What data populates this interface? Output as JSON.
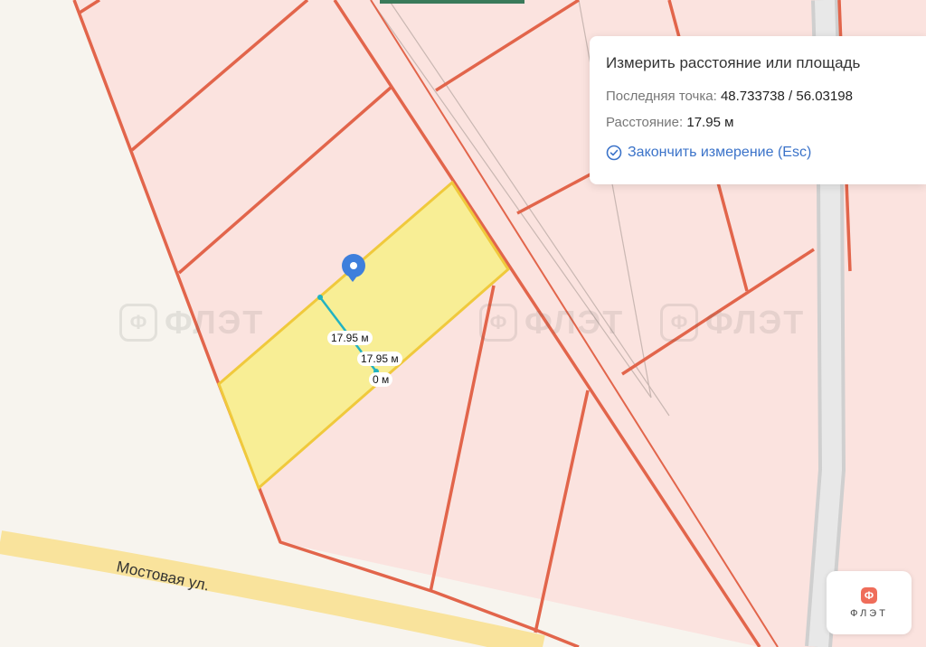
{
  "measure_panel": {
    "title": "Измерить расстояние или площадь",
    "last_point_label": "Последняя точка:",
    "last_point_value": "48.733738 / 56.03198",
    "distance_label": "Расстояние:",
    "distance_value": "17.95 м",
    "finish_label": "Закончить измерение (Esc)"
  },
  "map": {
    "street_name": "Мостовая ул.",
    "segment_labels": [
      "17.95 м",
      "17.95 м",
      "0 м"
    ],
    "colors": {
      "parcel_fill": "#fbe3df",
      "parcel_border": "#e2654b",
      "selected_fill": "#f8ee95",
      "selected_border": "#f0c93c",
      "measure_line": "#22b3c2",
      "marker": "#3e7fdc",
      "road": "#f9e39c"
    },
    "marker_icon": "location-pin-icon"
  },
  "watermark": {
    "badge": "Ф",
    "text": "ФЛЭТ"
  },
  "logo": {
    "badge": "Ф",
    "text": "ФЛЭТ"
  }
}
